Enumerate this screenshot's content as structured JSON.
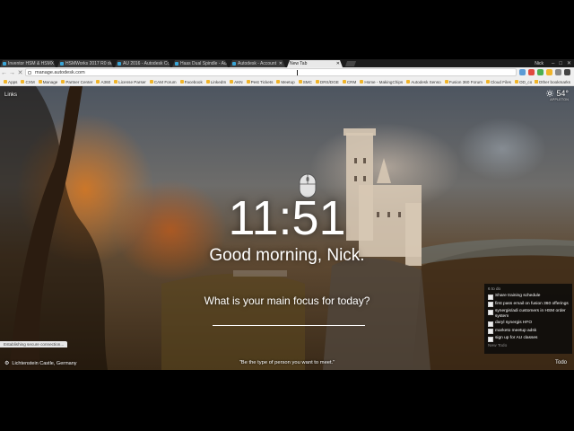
{
  "browser": {
    "tabs": [
      {
        "label": "Inventor HSM & HSMX"
      },
      {
        "label": "HSMWorks 2017 R0 de"
      },
      {
        "label": "AU 2016 - Autodesk Co"
      },
      {
        "label": "Haas Dual Spindle - Au"
      },
      {
        "label": "Autodesk - Account"
      },
      {
        "label": "New Tab",
        "active": true
      }
    ],
    "user": "Nick",
    "window_controls": [
      "–",
      "□",
      "✕"
    ],
    "address": "manage.autodesk.com",
    "bookmarks": [
      "Apps",
      "CXM",
      "Manage",
      "Partner Center",
      "A360",
      "License Parser",
      "CAM Forum",
      "Facebook",
      "LinkedIn",
      "AKN",
      "Pest Tickets",
      "Meetup",
      "SMC",
      "DRS/DGE",
      "CRM",
      "Home - MakingChips",
      "Autodesk Senso",
      "Fusion 360 Forum",
      "Cloud Files",
      "OD_consumption.pdf"
    ],
    "other_bookmarks": "Other bookmarks",
    "extension_colors": [
      "#5b9bd5",
      "#e04a3f",
      "#4caf50",
      "#f0b429",
      "#888888",
      "#444444"
    ]
  },
  "ntp": {
    "links_label": "Links",
    "weather": {
      "icon": "sun-icon",
      "temperature": "54°",
      "location": "APPLETON"
    },
    "clock": "11:51",
    "greeting": "Good morning, Nick.",
    "focus_question": "What is your main focus for today?",
    "focus_value": "",
    "photo_location": "Lichtenstein Castle, Germany",
    "quote": "\"Be the type of person you want to meet.\"",
    "todo_link": "Todo",
    "status_text": "Establishing secure connection..."
  },
  "todo": {
    "count": "6 to do",
    "items": [
      "Share training schedule",
      "first pass email on fusion 360 offerings",
      "synergis/adi customers in HSM order system",
      "daryl synergis HFO",
      "marketo meetup adsk",
      "sign up for AU classes"
    ],
    "new_todo": "New Todo"
  }
}
